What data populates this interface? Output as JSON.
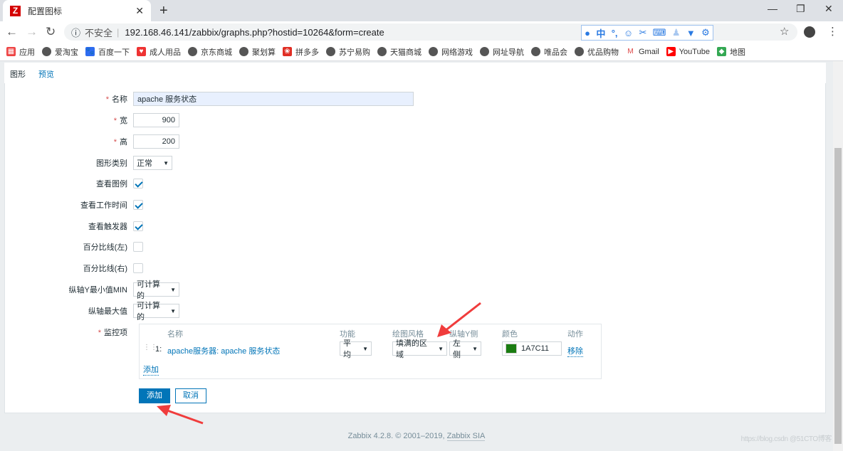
{
  "browser": {
    "tab_title": "配置图标",
    "url": "192.168.46.141/zabbix/graphs.php?hostid=10264&form=create",
    "insecure_label": "不安全",
    "bookmarks": [
      "应用",
      "爱淘宝",
      "百度一下",
      "成人用品",
      "京东商城",
      "聚划算",
      "拼多多",
      "苏宁易购",
      "天猫商城",
      "网络游戏",
      "网址导航",
      "唯品会",
      "优品购物",
      "Gmail",
      "YouTube",
      "地图"
    ]
  },
  "tabs": [
    {
      "label": "图形",
      "active": true
    },
    {
      "label": "预览",
      "active": false
    }
  ],
  "form": {
    "name": {
      "label": "名称",
      "value": "apache 服务状态"
    },
    "width": {
      "label": "宽",
      "value": "900"
    },
    "height": {
      "label": "高",
      "value": "200"
    },
    "graph_type": {
      "label": "图形类别",
      "value": "正常"
    },
    "show_legend": {
      "label": "查看图例",
      "checked": true
    },
    "show_work_period": {
      "label": "查看工作时间",
      "checked": true
    },
    "show_triggers": {
      "label": "查看触发器",
      "checked": true
    },
    "percentile_left": {
      "label": "百分比线(左)",
      "checked": false
    },
    "percentile_right": {
      "label": "百分比线(右)",
      "checked": false
    },
    "ymin": {
      "label": "纵轴Y最小值MIN",
      "value": "可计算的"
    },
    "ymax": {
      "label": "纵轴最大值",
      "value": "可计算的"
    },
    "items_label": "监控项",
    "items_headers": [
      "名称",
      "功能",
      "绘图风格",
      "纵轴Y侧",
      "颜色",
      "动作"
    ],
    "items": [
      {
        "index": "1:",
        "name": "apache服务器: apache 服务状态",
        "function": "平均",
        "draw_style": "填满的区域",
        "y_axis_side": "左侧",
        "color": "1A7C11",
        "action": "移除"
      }
    ],
    "add_item_link": "添加",
    "submit": "添加",
    "cancel": "取消"
  },
  "footer": {
    "text": "Zabbix 4.2.8. © 2001–2019, ",
    "link": "Zabbix SIA"
  },
  "watermark": "https://blog.csdn @51CTO博客",
  "colors": {
    "accent": "#0275b8",
    "item_color": "#1A7C11",
    "annotation_arrow": "#f03c3c"
  }
}
